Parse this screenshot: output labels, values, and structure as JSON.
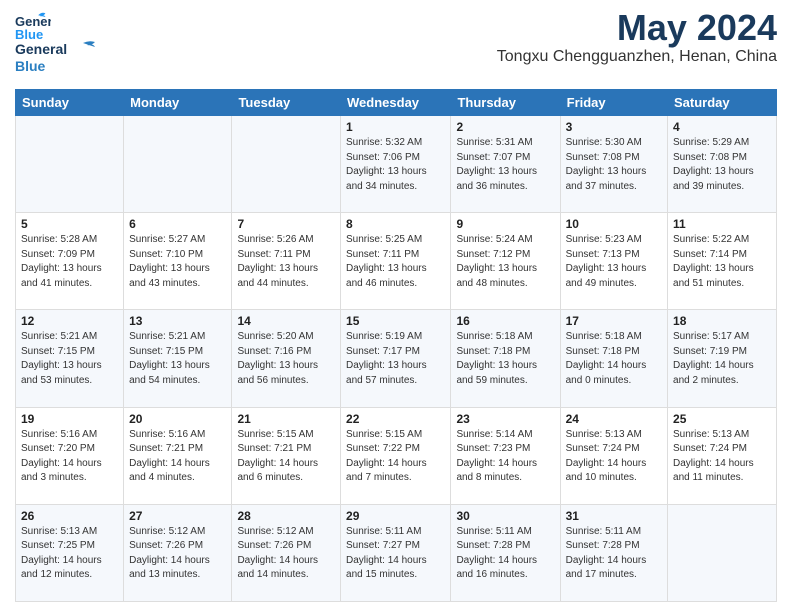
{
  "header": {
    "logo_line1": "General",
    "logo_line2": "Blue",
    "month_title": "May 2024",
    "location": "Tongxu Chengguanzhen, Henan, China"
  },
  "weekdays": [
    "Sunday",
    "Monday",
    "Tuesday",
    "Wednesday",
    "Thursday",
    "Friday",
    "Saturday"
  ],
  "weeks": [
    [
      {
        "day": "",
        "sunrise": "",
        "sunset": "",
        "daylight": ""
      },
      {
        "day": "",
        "sunrise": "",
        "sunset": "",
        "daylight": ""
      },
      {
        "day": "",
        "sunrise": "",
        "sunset": "",
        "daylight": ""
      },
      {
        "day": "1",
        "sunrise": "Sunrise: 5:32 AM",
        "sunset": "Sunset: 7:06 PM",
        "daylight": "Daylight: 13 hours and 34 minutes."
      },
      {
        "day": "2",
        "sunrise": "Sunrise: 5:31 AM",
        "sunset": "Sunset: 7:07 PM",
        "daylight": "Daylight: 13 hours and 36 minutes."
      },
      {
        "day": "3",
        "sunrise": "Sunrise: 5:30 AM",
        "sunset": "Sunset: 7:08 PM",
        "daylight": "Daylight: 13 hours and 37 minutes."
      },
      {
        "day": "4",
        "sunrise": "Sunrise: 5:29 AM",
        "sunset": "Sunset: 7:08 PM",
        "daylight": "Daylight: 13 hours and 39 minutes."
      }
    ],
    [
      {
        "day": "5",
        "sunrise": "Sunrise: 5:28 AM",
        "sunset": "Sunset: 7:09 PM",
        "daylight": "Daylight: 13 hours and 41 minutes."
      },
      {
        "day": "6",
        "sunrise": "Sunrise: 5:27 AM",
        "sunset": "Sunset: 7:10 PM",
        "daylight": "Daylight: 13 hours and 43 minutes."
      },
      {
        "day": "7",
        "sunrise": "Sunrise: 5:26 AM",
        "sunset": "Sunset: 7:11 PM",
        "daylight": "Daylight: 13 hours and 44 minutes."
      },
      {
        "day": "8",
        "sunrise": "Sunrise: 5:25 AM",
        "sunset": "Sunset: 7:11 PM",
        "daylight": "Daylight: 13 hours and 46 minutes."
      },
      {
        "day": "9",
        "sunrise": "Sunrise: 5:24 AM",
        "sunset": "Sunset: 7:12 PM",
        "daylight": "Daylight: 13 hours and 48 minutes."
      },
      {
        "day": "10",
        "sunrise": "Sunrise: 5:23 AM",
        "sunset": "Sunset: 7:13 PM",
        "daylight": "Daylight: 13 hours and 49 minutes."
      },
      {
        "day": "11",
        "sunrise": "Sunrise: 5:22 AM",
        "sunset": "Sunset: 7:14 PM",
        "daylight": "Daylight: 13 hours and 51 minutes."
      }
    ],
    [
      {
        "day": "12",
        "sunrise": "Sunrise: 5:21 AM",
        "sunset": "Sunset: 7:15 PM",
        "daylight": "Daylight: 13 hours and 53 minutes."
      },
      {
        "day": "13",
        "sunrise": "Sunrise: 5:21 AM",
        "sunset": "Sunset: 7:15 PM",
        "daylight": "Daylight: 13 hours and 54 minutes."
      },
      {
        "day": "14",
        "sunrise": "Sunrise: 5:20 AM",
        "sunset": "Sunset: 7:16 PM",
        "daylight": "Daylight: 13 hours and 56 minutes."
      },
      {
        "day": "15",
        "sunrise": "Sunrise: 5:19 AM",
        "sunset": "Sunset: 7:17 PM",
        "daylight": "Daylight: 13 hours and 57 minutes."
      },
      {
        "day": "16",
        "sunrise": "Sunrise: 5:18 AM",
        "sunset": "Sunset: 7:18 PM",
        "daylight": "Daylight: 13 hours and 59 minutes."
      },
      {
        "day": "17",
        "sunrise": "Sunrise: 5:18 AM",
        "sunset": "Sunset: 7:18 PM",
        "daylight": "Daylight: 14 hours and 0 minutes."
      },
      {
        "day": "18",
        "sunrise": "Sunrise: 5:17 AM",
        "sunset": "Sunset: 7:19 PM",
        "daylight": "Daylight: 14 hours and 2 minutes."
      }
    ],
    [
      {
        "day": "19",
        "sunrise": "Sunrise: 5:16 AM",
        "sunset": "Sunset: 7:20 PM",
        "daylight": "Daylight: 14 hours and 3 minutes."
      },
      {
        "day": "20",
        "sunrise": "Sunrise: 5:16 AM",
        "sunset": "Sunset: 7:21 PM",
        "daylight": "Daylight: 14 hours and 4 minutes."
      },
      {
        "day": "21",
        "sunrise": "Sunrise: 5:15 AM",
        "sunset": "Sunset: 7:21 PM",
        "daylight": "Daylight: 14 hours and 6 minutes."
      },
      {
        "day": "22",
        "sunrise": "Sunrise: 5:15 AM",
        "sunset": "Sunset: 7:22 PM",
        "daylight": "Daylight: 14 hours and 7 minutes."
      },
      {
        "day": "23",
        "sunrise": "Sunrise: 5:14 AM",
        "sunset": "Sunset: 7:23 PM",
        "daylight": "Daylight: 14 hours and 8 minutes."
      },
      {
        "day": "24",
        "sunrise": "Sunrise: 5:13 AM",
        "sunset": "Sunset: 7:24 PM",
        "daylight": "Daylight: 14 hours and 10 minutes."
      },
      {
        "day": "25",
        "sunrise": "Sunrise: 5:13 AM",
        "sunset": "Sunset: 7:24 PM",
        "daylight": "Daylight: 14 hours and 11 minutes."
      }
    ],
    [
      {
        "day": "26",
        "sunrise": "Sunrise: 5:13 AM",
        "sunset": "Sunset: 7:25 PM",
        "daylight": "Daylight: 14 hours and 12 minutes."
      },
      {
        "day": "27",
        "sunrise": "Sunrise: 5:12 AM",
        "sunset": "Sunset: 7:26 PM",
        "daylight": "Daylight: 14 hours and 13 minutes."
      },
      {
        "day": "28",
        "sunrise": "Sunrise: 5:12 AM",
        "sunset": "Sunset: 7:26 PM",
        "daylight": "Daylight: 14 hours and 14 minutes."
      },
      {
        "day": "29",
        "sunrise": "Sunrise: 5:11 AM",
        "sunset": "Sunset: 7:27 PM",
        "daylight": "Daylight: 14 hours and 15 minutes."
      },
      {
        "day": "30",
        "sunrise": "Sunrise: 5:11 AM",
        "sunset": "Sunset: 7:28 PM",
        "daylight": "Daylight: 14 hours and 16 minutes."
      },
      {
        "day": "31",
        "sunrise": "Sunrise: 5:11 AM",
        "sunset": "Sunset: 7:28 PM",
        "daylight": "Daylight: 14 hours and 17 minutes."
      },
      {
        "day": "",
        "sunrise": "",
        "sunset": "",
        "daylight": ""
      }
    ]
  ]
}
